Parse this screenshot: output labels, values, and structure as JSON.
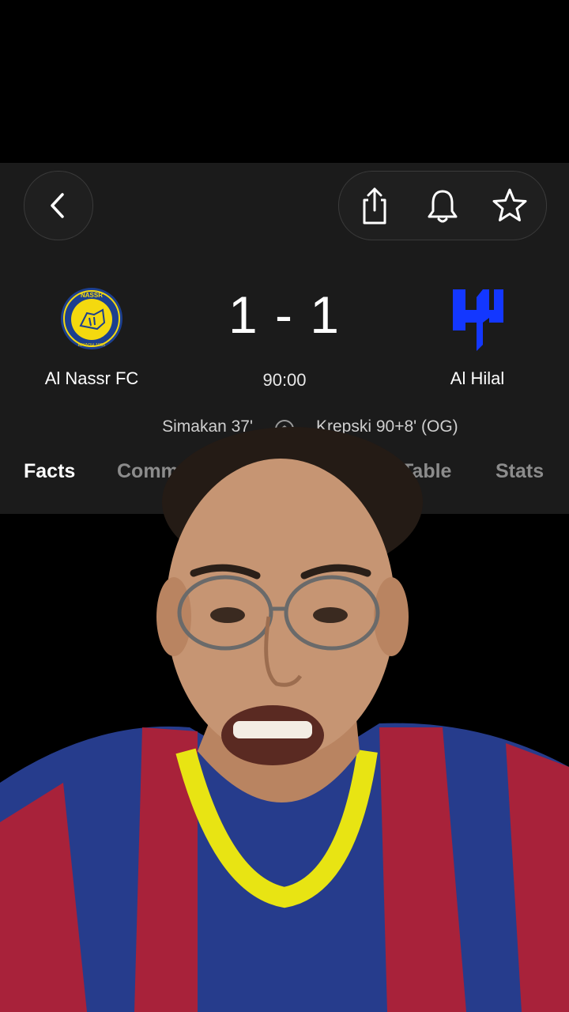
{
  "header": {
    "back_icon": "chevron-left-icon",
    "share_icon": "share-icon",
    "bell_icon": "bell-icon",
    "star_icon": "star-icon"
  },
  "match": {
    "home_team": "Al Nassr FC",
    "away_team": "Al Hilal",
    "home_crest_text": "NASSR",
    "home_crest_subtext": "RIYADH 1955",
    "score": "1 - 1",
    "clock": "90:00",
    "home_scorer": "Simakan 37'",
    "away_scorer": "Krepski 90+8' (OG)"
  },
  "tabs": {
    "facts": "Facts",
    "commentary": "Comm",
    "table": "Table",
    "stats": "Stats"
  },
  "colors": {
    "panel": "#1b1b1b",
    "nassr_yellow": "#f4d90f",
    "nassr_blue": "#1c3f8f",
    "hilal_blue": "#1337ff",
    "jersey_red": "#a8223a",
    "jersey_blue": "#263c8c"
  }
}
